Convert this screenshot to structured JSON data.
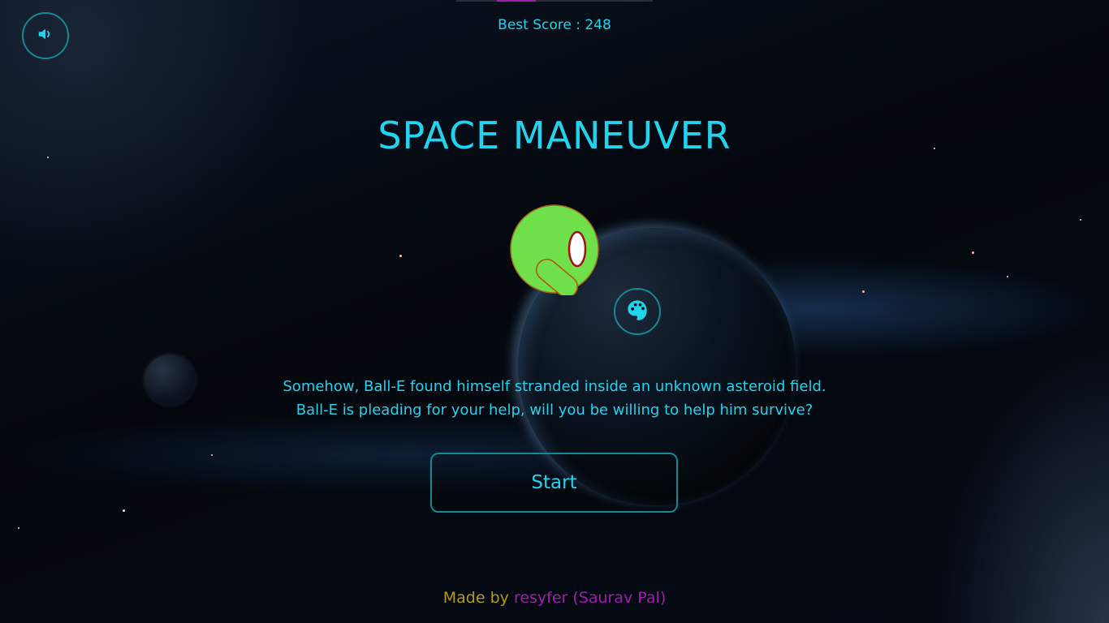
{
  "header": {
    "best_score": "Best Score : 248"
  },
  "controls": {
    "sound_icon": "speaker-icon",
    "palette_icon": "palette-icon"
  },
  "main": {
    "title": "SPACE MANEUVER",
    "story_line_1": "Somehow, Ball-E found himself stranded inside an unknown asteroid field.",
    "story_line_2": "Ball-E is pleading for your help, will you be willing to help him survive?",
    "start_label": "Start"
  },
  "footer": {
    "made_by": "Made by",
    "author": "resyfer (Saurav Pal)"
  },
  "colors": {
    "accent": "#22d3ee",
    "button_border": "#138a93",
    "ball_fill": "#6fe04a",
    "ball_outline": "#b45309",
    "made_by_color": "#b39b16",
    "author_color": "#a21caf"
  }
}
